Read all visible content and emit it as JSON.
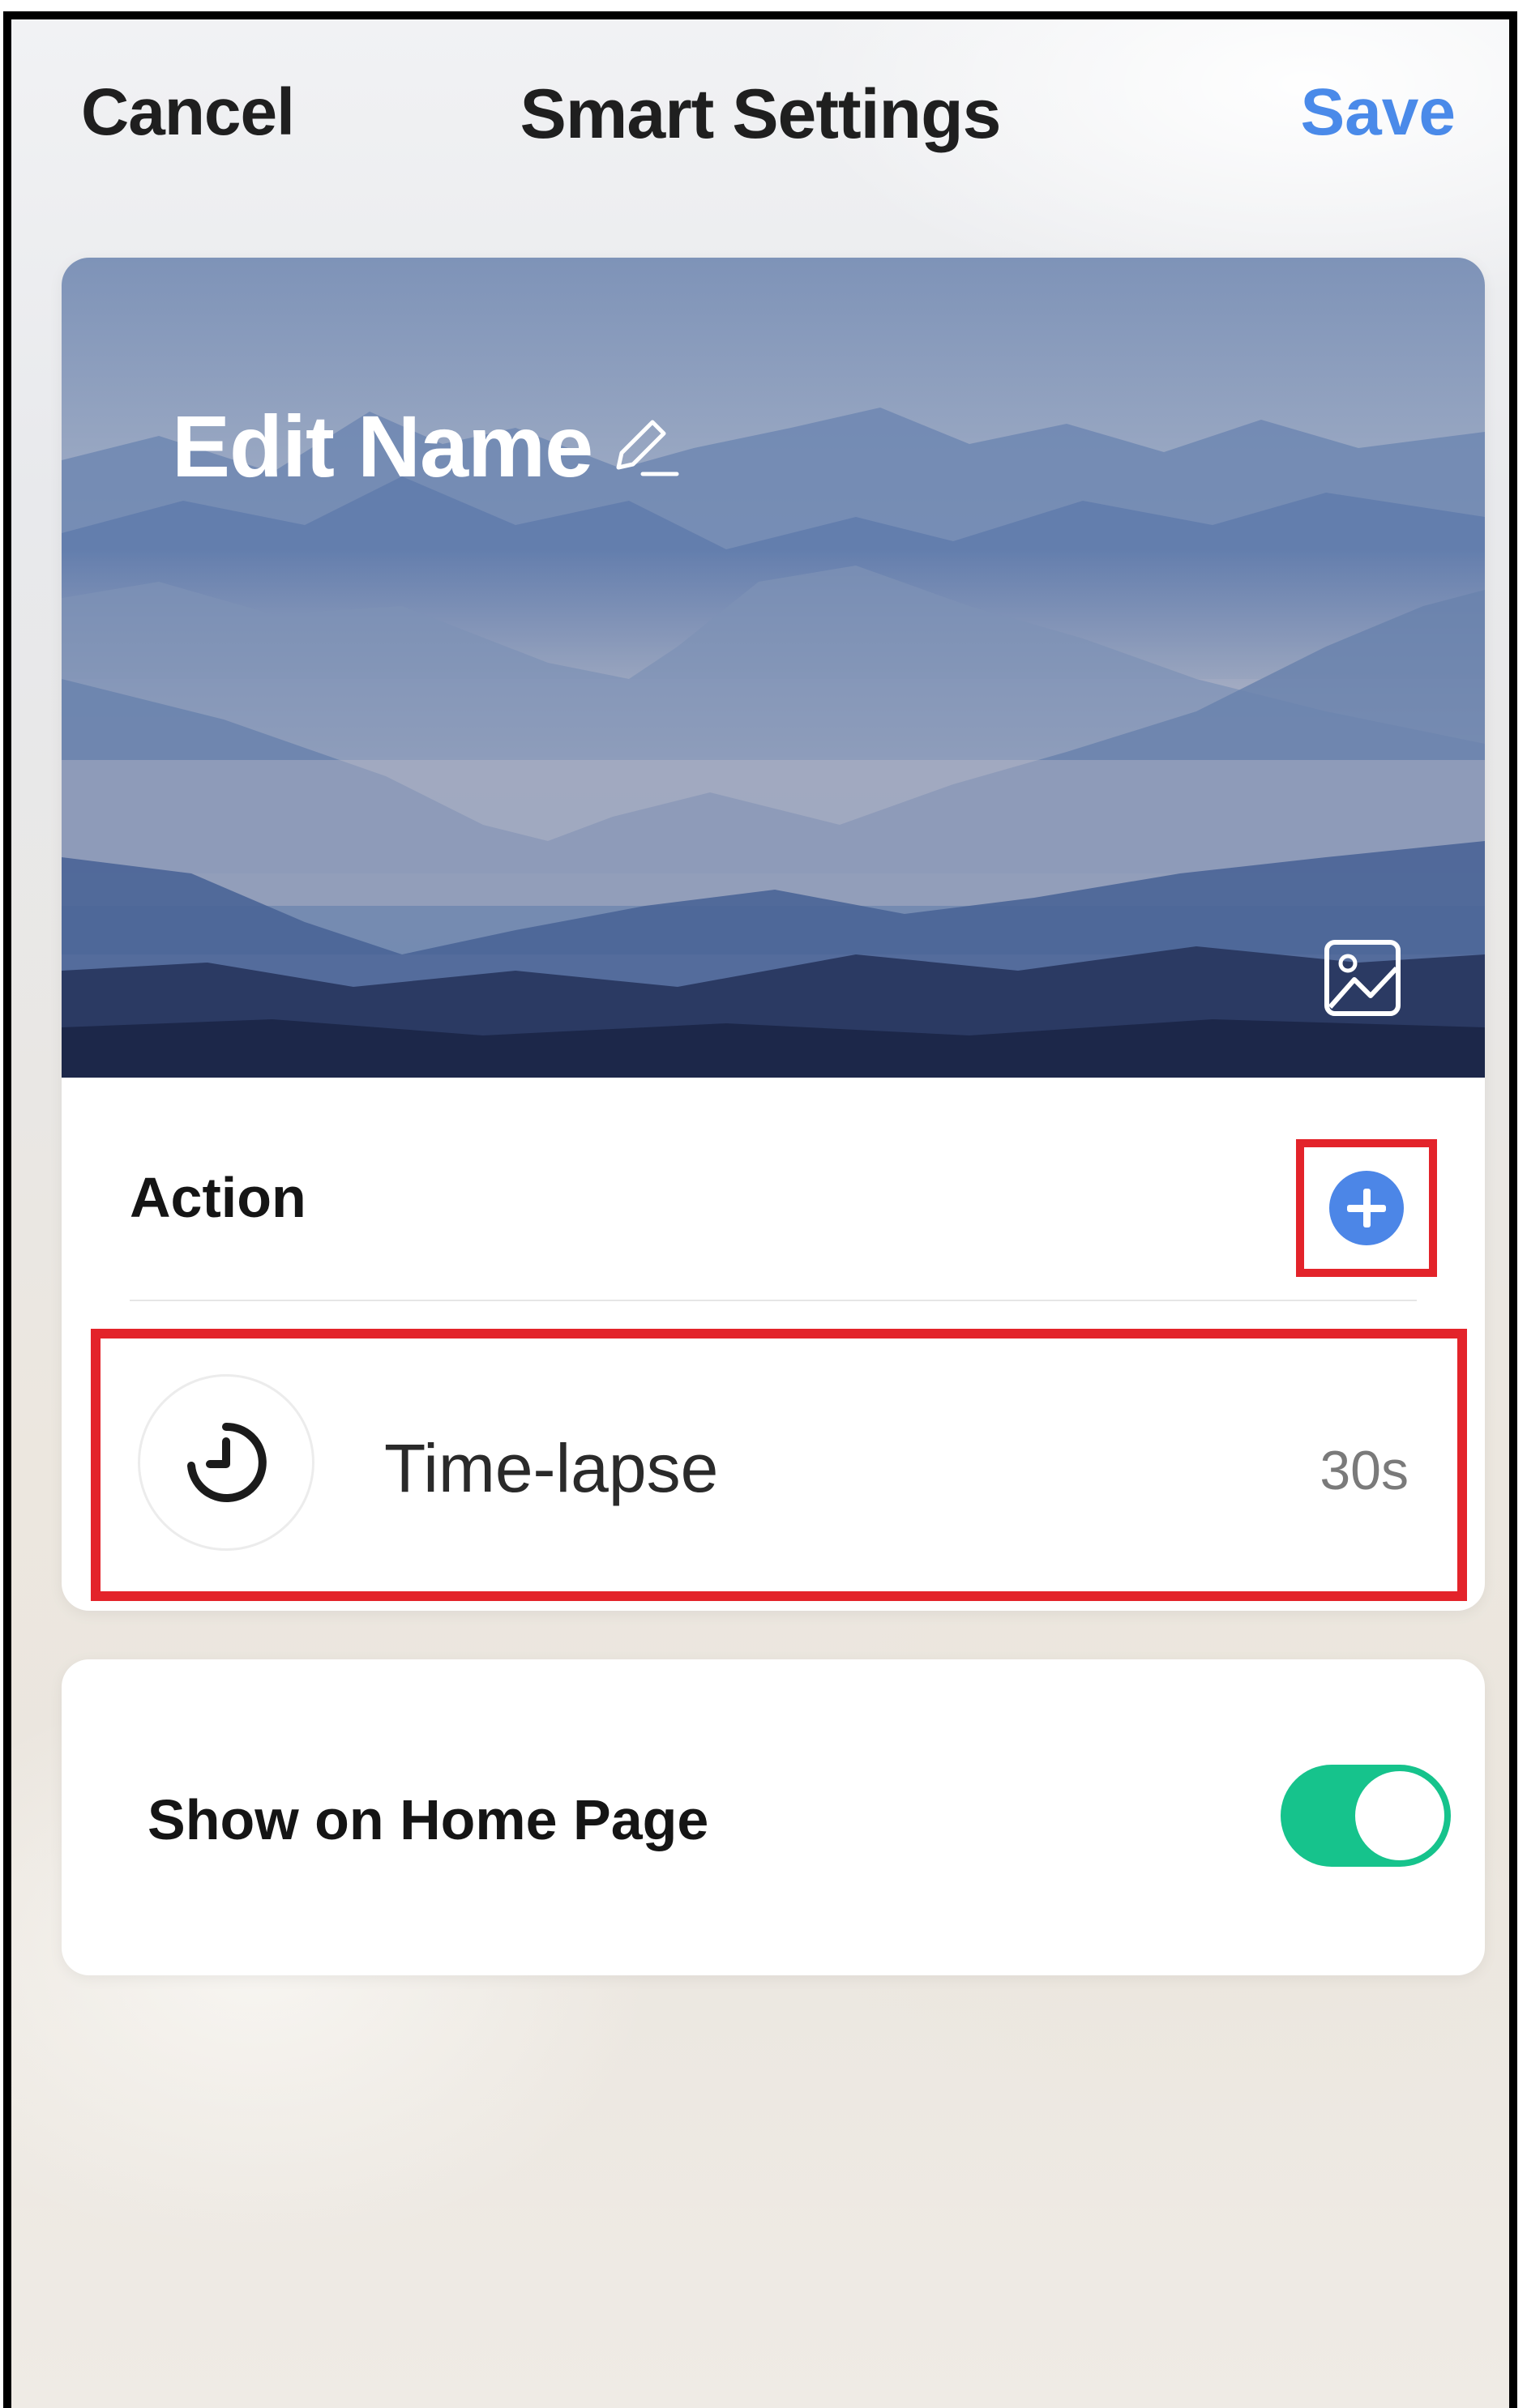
{
  "header": {
    "cancel_label": "Cancel",
    "title": "Smart Settings",
    "save_label": "Save"
  },
  "banner": {
    "name_label": "Edit Name",
    "edit_icon": "pencil-icon",
    "change_image_icon": "image-icon"
  },
  "action": {
    "label": "Action",
    "add_icon": "plus-circle-icon",
    "items": [
      {
        "icon": "timer-icon",
        "name": "Time-lapse",
        "value": "30s"
      }
    ]
  },
  "settings": {
    "show_home_label": "Show on Home Page",
    "show_home_enabled": true
  },
  "colors": {
    "accent": "#4a8ae9",
    "add_button": "#4c86e7",
    "toggle_on": "#16c38c",
    "highlight": "#e3232a"
  }
}
